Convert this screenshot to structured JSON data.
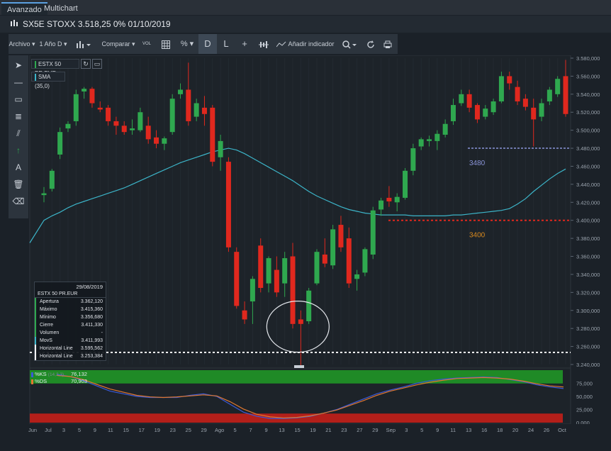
{
  "tabs": [
    "Avanzado",
    "Multichart"
  ],
  "title": "SX5E STOXX 3.518,25 0% 01/10/2019",
  "toolbar": {
    "archivo": "Archivo ▾",
    "period": "1 Año D ▾",
    "comparar": "Comparar ▾",
    "vol": "VOL",
    "pct": "% ▾",
    "d": "D",
    "l": "L",
    "indicador": "Añadir indicador ▾"
  },
  "legend": {
    "instrument": "ESTX 50 PR.EUR",
    "sma": "SMA (35,0)"
  },
  "info_panel": {
    "date": "29/08/2019",
    "name": "ESTX 50 PR.EUR",
    "rows": [
      {
        "label": "Apertura",
        "value": "3.362,120"
      },
      {
        "label": "Máximo",
        "value": "3.415,360"
      },
      {
        "label": "Mínimo",
        "value": "3.356,680"
      },
      {
        "label": "Cierre",
        "value": "3.411,330"
      },
      {
        "label": "Volumen",
        "value": "-"
      },
      {
        "label": "MovS",
        "value": "3.411,993"
      },
      {
        "label": "Horizontal Line",
        "value": "3.595,562"
      },
      {
        "label": "Horizontal Line",
        "value": "3.253,384"
      }
    ]
  },
  "indicator_legend": {
    "k": "%KS",
    "k_value": "76,132",
    "d": "%DS",
    "d_value": "70,903",
    "params": "(14,3,3)"
  },
  "colors": {
    "up": "#2fa84f",
    "down": "#e0281e",
    "sma": "#3cb4c8",
    "k_line": "#3a5ad8",
    "d_line": "#e07830",
    "overbought": "#1f8a26",
    "oversold": "#b31f1a"
  },
  "chart_data": {
    "type": "candlestick",
    "ylim": [
      3240,
      3580
    ],
    "y_ticks": [
      "3.580,000",
      "3.560,000",
      "3.540,000",
      "3.520,000",
      "3.500,000",
      "3.480,000",
      "3.460,000",
      "3.440,000",
      "3.420,000",
      "3.400,000",
      "3.380,000",
      "3.360,000",
      "3.340,000",
      "3.320,000",
      "3.300,000",
      "3.280,000",
      "3.260,000",
      "3.240,000"
    ],
    "x_tick_labels": [
      "Jun",
      "Jul",
      "3",
      "5",
      "9",
      "11",
      "15",
      "17",
      "19",
      "23",
      "25",
      "29",
      "Ago",
      "5",
      "7",
      "9",
      "13",
      "15",
      "19",
      "21",
      "23",
      "27",
      "29",
      "Sep",
      "3",
      "5",
      "9",
      "11",
      "13",
      "16",
      "18",
      "20",
      "24",
      "26",
      "Oct"
    ],
    "candles": [
      {
        "o": 3428,
        "h": 3437,
        "l": 3420,
        "c": 3430
      },
      {
        "o": 3435,
        "h": 3457,
        "l": 3432,
        "c": 3455
      },
      {
        "o": 3473,
        "h": 3503,
        "l": 3468,
        "c": 3498
      },
      {
        "o": 3502,
        "h": 3510,
        "l": 3498,
        "c": 3507
      },
      {
        "o": 3510,
        "h": 3545,
        "l": 3505,
        "c": 3540
      },
      {
        "o": 3543,
        "h": 3548,
        "l": 3535,
        "c": 3546
      },
      {
        "o": 3546,
        "h": 3548,
        "l": 3525,
        "c": 3530
      },
      {
        "o": 3525,
        "h": 3532,
        "l": 3520,
        "c": 3523
      },
      {
        "o": 3525,
        "h": 3528,
        "l": 3505,
        "c": 3510
      },
      {
        "o": 3510,
        "h": 3515,
        "l": 3495,
        "c": 3505
      },
      {
        "o": 3505,
        "h": 3510,
        "l": 3495,
        "c": 3498
      },
      {
        "o": 3500,
        "h": 3512,
        "l": 3495,
        "c": 3502
      },
      {
        "o": 3500,
        "h": 3525,
        "l": 3498,
        "c": 3520
      },
      {
        "o": 3505,
        "h": 3515,
        "l": 3485,
        "c": 3490
      },
      {
        "o": 3492,
        "h": 3500,
        "l": 3480,
        "c": 3485
      },
      {
        "o": 3485,
        "h": 3493,
        "l": 3478,
        "c": 3491
      },
      {
        "o": 3498,
        "h": 3540,
        "l": 3495,
        "c": 3535
      },
      {
        "o": 3540,
        "h": 3552,
        "l": 3535,
        "c": 3545
      },
      {
        "o": 3545,
        "h": 3575,
        "l": 3505,
        "c": 3510
      },
      {
        "o": 3515,
        "h": 3535,
        "l": 3510,
        "c": 3530
      },
      {
        "o": 3525,
        "h": 3538,
        "l": 3505,
        "c": 3518
      },
      {
        "o": 3525,
        "h": 3528,
        "l": 3460,
        "c": 3465
      },
      {
        "o": 3470,
        "h": 3495,
        "l": 3455,
        "c": 3488
      },
      {
        "o": 3465,
        "h": 3470,
        "l": 3365,
        "c": 3370
      },
      {
        "o": 3365,
        "h": 3370,
        "l": 3302,
        "c": 3305
      },
      {
        "o": 3300,
        "h": 3310,
        "l": 3285,
        "c": 3290
      },
      {
        "o": 3310,
        "h": 3338,
        "l": 3285,
        "c": 3335
      },
      {
        "o": 3372,
        "h": 3380,
        "l": 3320,
        "c": 3325
      },
      {
        "o": 3330,
        "h": 3360,
        "l": 3320,
        "c": 3358
      },
      {
        "o": 3345,
        "h": 3360,
        "l": 3315,
        "c": 3320
      },
      {
        "o": 3330,
        "h": 3365,
        "l": 3315,
        "c": 3358
      },
      {
        "o": 3360,
        "h": 3375,
        "l": 3280,
        "c": 3285
      },
      {
        "o": 3290,
        "h": 3300,
        "l": 3236,
        "c": 3285
      },
      {
        "o": 3288,
        "h": 3325,
        "l": 3285,
        "c": 3322
      },
      {
        "o": 3330,
        "h": 3368,
        "l": 3328,
        "c": 3365
      },
      {
        "o": 3362,
        "h": 3380,
        "l": 3348,
        "c": 3352
      },
      {
        "o": 3350,
        "h": 3395,
        "l": 3346,
        "c": 3390
      },
      {
        "o": 3395,
        "h": 3405,
        "l": 3365,
        "c": 3370
      },
      {
        "o": 3380,
        "h": 3392,
        "l": 3325,
        "c": 3330
      },
      {
        "o": 3335,
        "h": 3345,
        "l": 3322,
        "c": 3340
      },
      {
        "o": 3342,
        "h": 3370,
        "l": 3338,
        "c": 3368
      },
      {
        "o": 3362,
        "h": 3415,
        "l": 3357,
        "c": 3411
      },
      {
        "o": 3412,
        "h": 3425,
        "l": 3405,
        "c": 3422
      },
      {
        "o": 3425,
        "h": 3438,
        "l": 3415,
        "c": 3421
      },
      {
        "o": 3420,
        "h": 3430,
        "l": 3410,
        "c": 3426
      },
      {
        "o": 3425,
        "h": 3458,
        "l": 3423,
        "c": 3455
      },
      {
        "o": 3455,
        "h": 3485,
        "l": 3450,
        "c": 3480
      },
      {
        "o": 3482,
        "h": 3492,
        "l": 3478,
        "c": 3490
      },
      {
        "o": 3488,
        "h": 3494,
        "l": 3482,
        "c": 3490
      },
      {
        "o": 3488,
        "h": 3500,
        "l": 3478,
        "c": 3496
      },
      {
        "o": 3495,
        "h": 3512,
        "l": 3492,
        "c": 3507
      },
      {
        "o": 3510,
        "h": 3535,
        "l": 3506,
        "c": 3528
      },
      {
        "o": 3530,
        "h": 3545,
        "l": 3527,
        "c": 3540
      },
      {
        "o": 3540,
        "h": 3545,
        "l": 3520,
        "c": 3525
      },
      {
        "o": 3528,
        "h": 3530,
        "l": 3508,
        "c": 3512
      },
      {
        "o": 3515,
        "h": 3528,
        "l": 3512,
        "c": 3524
      },
      {
        "o": 3520,
        "h": 3535,
        "l": 3517,
        "c": 3532
      },
      {
        "o": 3532,
        "h": 3565,
        "l": 3530,
        "c": 3560
      },
      {
        "o": 3560,
        "h": 3565,
        "l": 3545,
        "c": 3552
      },
      {
        "o": 3548,
        "h": 3555,
        "l": 3528,
        "c": 3532
      },
      {
        "o": 3535,
        "h": 3540,
        "l": 3522,
        "c": 3526
      },
      {
        "o": 3525,
        "h": 3535,
        "l": 3482,
        "c": 3512
      },
      {
        "o": 3515,
        "h": 3535,
        "l": 3510,
        "c": 3530
      },
      {
        "o": 3532,
        "h": 3548,
        "l": 3528,
        "c": 3545
      },
      {
        "o": 3540,
        "h": 3560,
        "l": 3537,
        "c": 3557
      },
      {
        "o": 3560,
        "h": 3578,
        "l": 3515,
        "c": 3518
      }
    ],
    "sma": [
      3400,
      3405,
      3409,
      3414,
      3418,
      3421,
      3424,
      3427,
      3430,
      3433,
      3436,
      3440,
      3444,
      3448,
      3452,
      3456,
      3460,
      3464,
      3467,
      3470,
      3473,
      3476,
      3478,
      3480,
      3478,
      3474,
      3469,
      3464,
      3459,
      3454,
      3449,
      3444,
      3438,
      3432,
      3427,
      3423,
      3419,
      3415,
      3412,
      3410,
      3408,
      3407,
      3406,
      3406,
      3406,
      3406,
      3405,
      3405,
      3405,
      3405,
      3405,
      3406,
      3406,
      3407,
      3408,
      3409,
      3410,
      3411,
      3413,
      3418,
      3424,
      3432,
      3439,
      3446,
      3452,
      3457
    ],
    "horizontal_lines": [
      {
        "value": 3480,
        "label": "3480",
        "color": "#8a94d8"
      },
      {
        "value": 3400,
        "label": "3400",
        "color": "#e0281e",
        "label_color": "#d8891e"
      },
      {
        "value": 3253.384,
        "label": "",
        "color": "#ffffff"
      }
    ],
    "stochastic": {
      "ylim": [
        0,
        100
      ],
      "y_ticks": [
        "75,000",
        "50,000",
        "25,000",
        "0,000"
      ],
      "k": [
        92,
        88,
        80,
        70,
        60,
        55,
        50,
        48,
        48,
        48,
        52,
        55,
        50,
        35,
        20,
        12,
        8,
        8,
        9,
        12,
        18,
        25,
        35,
        45,
        55,
        62,
        68,
        75,
        80,
        83,
        85,
        86,
        87,
        86,
        82,
        78,
        72,
        68,
        65
      ],
      "d": [
        90,
        88,
        82,
        73,
        64,
        58,
        52,
        49,
        48,
        49,
        51,
        53,
        51,
        40,
        26,
        16,
        11,
        9,
        10,
        13,
        18,
        24,
        33,
        42,
        52,
        60,
        66,
        72,
        77,
        81,
        84,
        85,
        86,
        85,
        83,
        79,
        74,
        70,
        68
      ],
      "overbought": 80,
      "oversold": 20
    }
  }
}
